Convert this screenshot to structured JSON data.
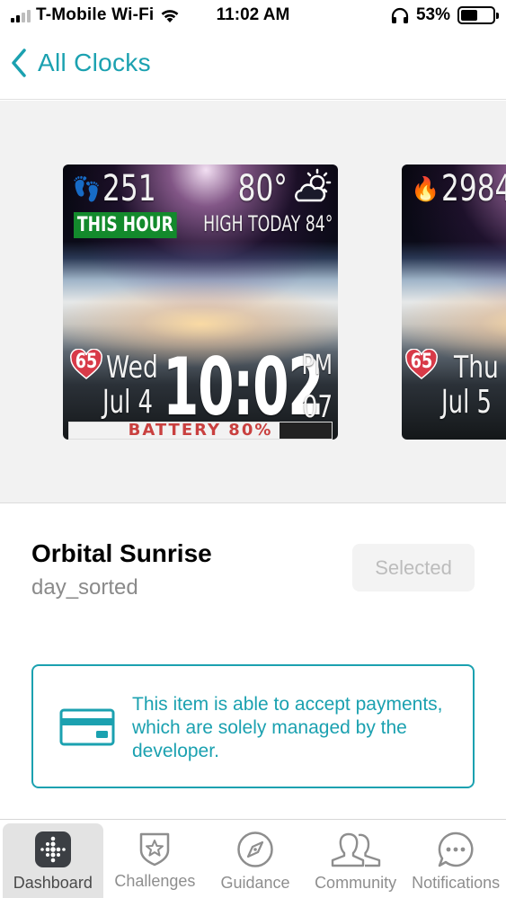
{
  "status_bar": {
    "carrier": "T-Mobile Wi-Fi",
    "time": "11:02 AM",
    "battery_percent": "53%",
    "battery_level": 0.53
  },
  "nav": {
    "back_label": "All Clocks"
  },
  "carousel": {
    "main_watch": {
      "steps": "251",
      "temperature": "80°",
      "this_hour_label": "THIS HOUR",
      "high_today": "HIGH TODAY 84°",
      "heart_rate": "65",
      "day": "Wed",
      "date": "Jul 4",
      "time": "10:02",
      "ampm": "PM",
      "seconds": "07",
      "battery_label": "BATTERY 80%",
      "battery_level": 0.8
    },
    "next_watch": {
      "calories": "2984",
      "heart_rate": "65",
      "day": "Thu",
      "date": "Jul 5"
    }
  },
  "clock": {
    "name": "Orbital Sunrise",
    "author": "day_sorted",
    "selected_label": "Selected"
  },
  "payment_notice": {
    "text": "This item is able to accept payments, which are solely managed by the developer."
  },
  "tab_bar": {
    "tabs": [
      {
        "label": "Dashboard",
        "icon": "dashboard-icon"
      },
      {
        "label": "Challenges",
        "icon": "challenges-icon"
      },
      {
        "label": "Guidance",
        "icon": "compass-icon"
      },
      {
        "label": "Community",
        "icon": "community-icon"
      },
      {
        "label": "Notifications",
        "icon": "chat-bubble-icon"
      }
    ]
  },
  "colors": {
    "accent": "#1ba1b0",
    "this_hour_bg": "#138a2c",
    "heart": "#d83a48",
    "battery_text": "#c9403f"
  }
}
